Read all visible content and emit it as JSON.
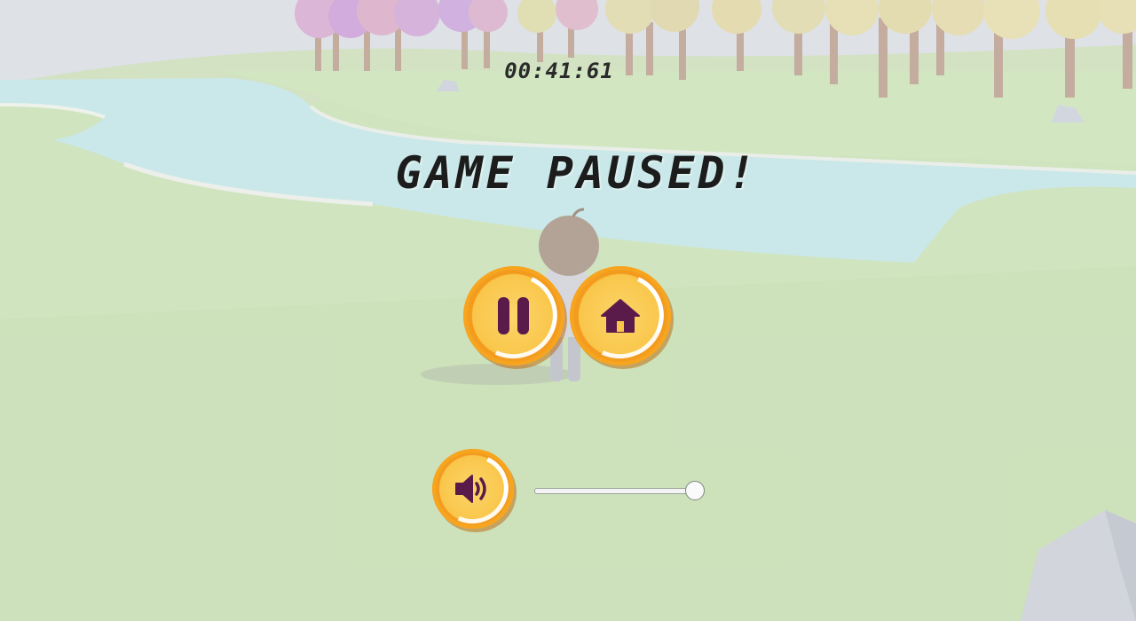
{
  "hud": {
    "timer": "00:41:61"
  },
  "pause_menu": {
    "title": "GAME PAUSED!",
    "buttons": {
      "pause_icon": "pause-icon",
      "home_icon": "home-icon"
    },
    "sound": {
      "icon": "speaker-icon",
      "volume": 1.0
    }
  },
  "colors": {
    "coin_face": "#f9c64a",
    "coin_rim": "#f39a1d",
    "glyph": "#5a1a4a",
    "grass": "#c2dcad",
    "river": "#bfe3e4"
  }
}
